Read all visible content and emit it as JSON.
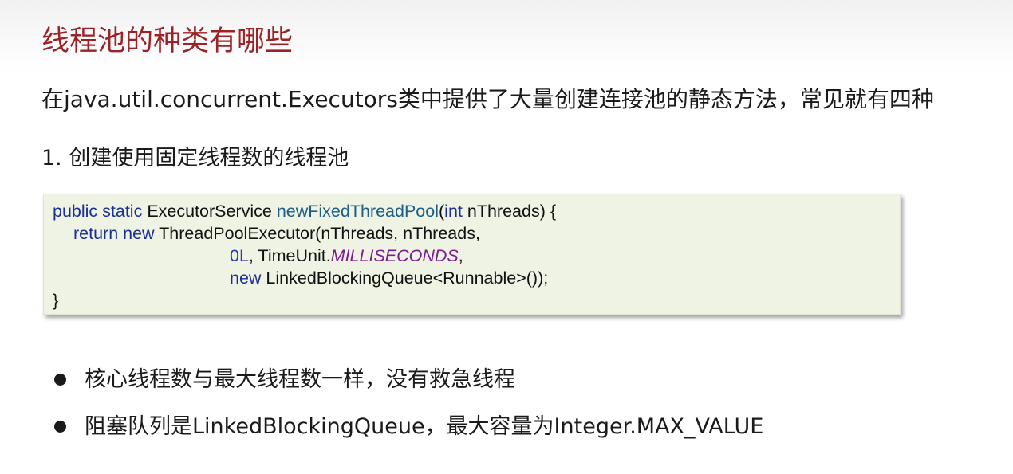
{
  "slide": {
    "title": "线程池的种类有哪些",
    "intro": "在java.util.concurrent.Executors类中提供了大量创建连接池的静态方法，常见就有四种",
    "section_heading": "1. 创建使用固定线程数的线程池"
  },
  "code": {
    "line1": {
      "kw": "public static",
      "type": " ExecutorService ",
      "method": "newFixedThreadPool",
      "open": "(",
      "param_kw": "int",
      "rest": " nThreads) {"
    },
    "line2": {
      "kw": "return new",
      "rest": " ThreadPoolExecutor(nThreads, nThreads,"
    },
    "line3": {
      "num": "0L",
      "mid": ", TimeUnit.",
      "const": "MILLISECONDS",
      "end": ","
    },
    "line4": {
      "kw": "new",
      "rest": " LinkedBlockingQueue<Runnable>());"
    },
    "line5": {
      "text": "}"
    }
  },
  "bullets": [
    "核心线程数与最大线程数一样，没有救急线程",
    "阻塞队列是LinkedBlockingQueue，最大容量为Integer.MAX_VALUE"
  ],
  "colors": {
    "title": "#9b2226",
    "code_background": "#eef3e4",
    "keyword": "#1a2f94",
    "constant": "#7a1d8f"
  }
}
